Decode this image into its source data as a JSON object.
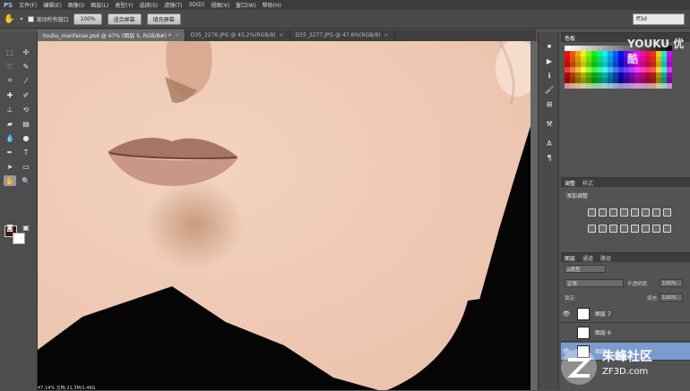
{
  "menubar": {
    "logo": "PS",
    "items": [
      "文件(F)",
      "编辑(E)",
      "图像(I)",
      "图层(L)",
      "类型(Y)",
      "选择(S)",
      "滤镜(T)",
      "3D(D)",
      "视图(V)",
      "窗口(W)",
      "帮助(H)"
    ]
  },
  "options": {
    "scroll_all_label": "滚动所有窗口",
    "zoom_button": "100%",
    "fit_screen_button": "适合屏幕",
    "fill_screen_button": "填充屏幕",
    "workspace": "ff3d"
  },
  "tabs": [
    {
      "label": "toubu_manfanse.psd @ 47% (图层 5, RGB/8#) *",
      "close": "×"
    },
    {
      "label": "D35_2276.JPG @ 43.2%(RGB/8)",
      "close": "×"
    },
    {
      "label": "D35_2277.JPG @ 47.6%(RGB/8)",
      "close": "×"
    }
  ],
  "panels": {
    "swatches_tab": "色板",
    "adjust_tabs": [
      "调整",
      "样式"
    ],
    "adjust_title": "添加调整",
    "layers_tabs": [
      "图层",
      "通道",
      "路径"
    ],
    "filter_kind": "ρ类型",
    "blend_mode": "正常",
    "opacity_label": "不透明度:",
    "opacity_value": "100%",
    "lock_label": "锁定:",
    "fill_label": "填充:",
    "fill_value": "100%",
    "layers": [
      {
        "name": "图层 7",
        "eye": "👁",
        "selected": false
      },
      {
        "name": "图层 6",
        "eye": "",
        "selected": false
      },
      {
        "name": "图层 5",
        "eye": "👁",
        "selected": true
      }
    ]
  },
  "watermark": "YOUKU 优酷",
  "site": {
    "name": "朱峰社区",
    "url": "ZF3D.com"
  },
  "status": "47.14% 文档:21.3M/1.49G",
  "colors": {
    "fg": "#3c1c12",
    "bg": "#ffffff",
    "skin": "#efc9b2"
  },
  "icons": [
    "hand-tool-icon",
    "move-tool-icon",
    "marquee-tool-icon",
    "lasso-tool-icon",
    "quick-select-icon",
    "crop-tool-icon",
    "eyedropper-icon",
    "healing-brush-icon",
    "brush-tool-icon",
    "clone-stamp-icon",
    "history-brush-icon",
    "eraser-icon",
    "gradient-icon",
    "blur-icon",
    "dodge-icon",
    "pen-tool-icon",
    "type-tool-icon",
    "path-select-icon",
    "shape-tool-icon",
    "zoom-tool-icon"
  ]
}
